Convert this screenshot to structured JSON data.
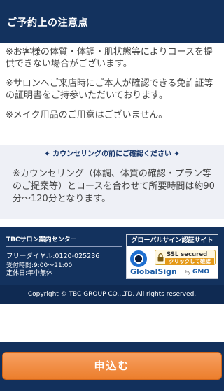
{
  "header": {
    "title": "ご予約上の注意点"
  },
  "notes": [
    "※お客様の体質・体調・肌状態等によりコースを提供できない場合がございます。",
    "※サロンへご来店時にご本人が確認できる免許証等の証明書をご持参いただいております。",
    "※メイク用品のご用意はございません。"
  ],
  "counseling": {
    "heading": "カウンセリングの前にご確認ください",
    "body": "※カウンセリング（体調、体質の確認・プラン等のご提案等）とコースを合わせて所要時間は約90分〜120分となります。"
  },
  "footer": {
    "center_name": "TBCサロン案内センター",
    "dial": "フリーダイヤル:0120-025236",
    "hours": "受付時間:9:00〜21:00",
    "closed": "定休日:年中無休",
    "globalsign": {
      "title": "グローバルサイン認証サイト",
      "ssl_line1": "SSL secured",
      "ssl_line2": "クリックして確認",
      "brand": "GlobalSign",
      "by": "by",
      "gmo": "GMO"
    },
    "copyright": "Copyright © TBC GROUP CO.,LTD. All rights reserved."
  },
  "cta": {
    "apply_label": "申込む"
  },
  "colors": {
    "navy": "#13325e",
    "orange": "#ec7e2c",
    "counsel_bg": "#eef0f6"
  }
}
